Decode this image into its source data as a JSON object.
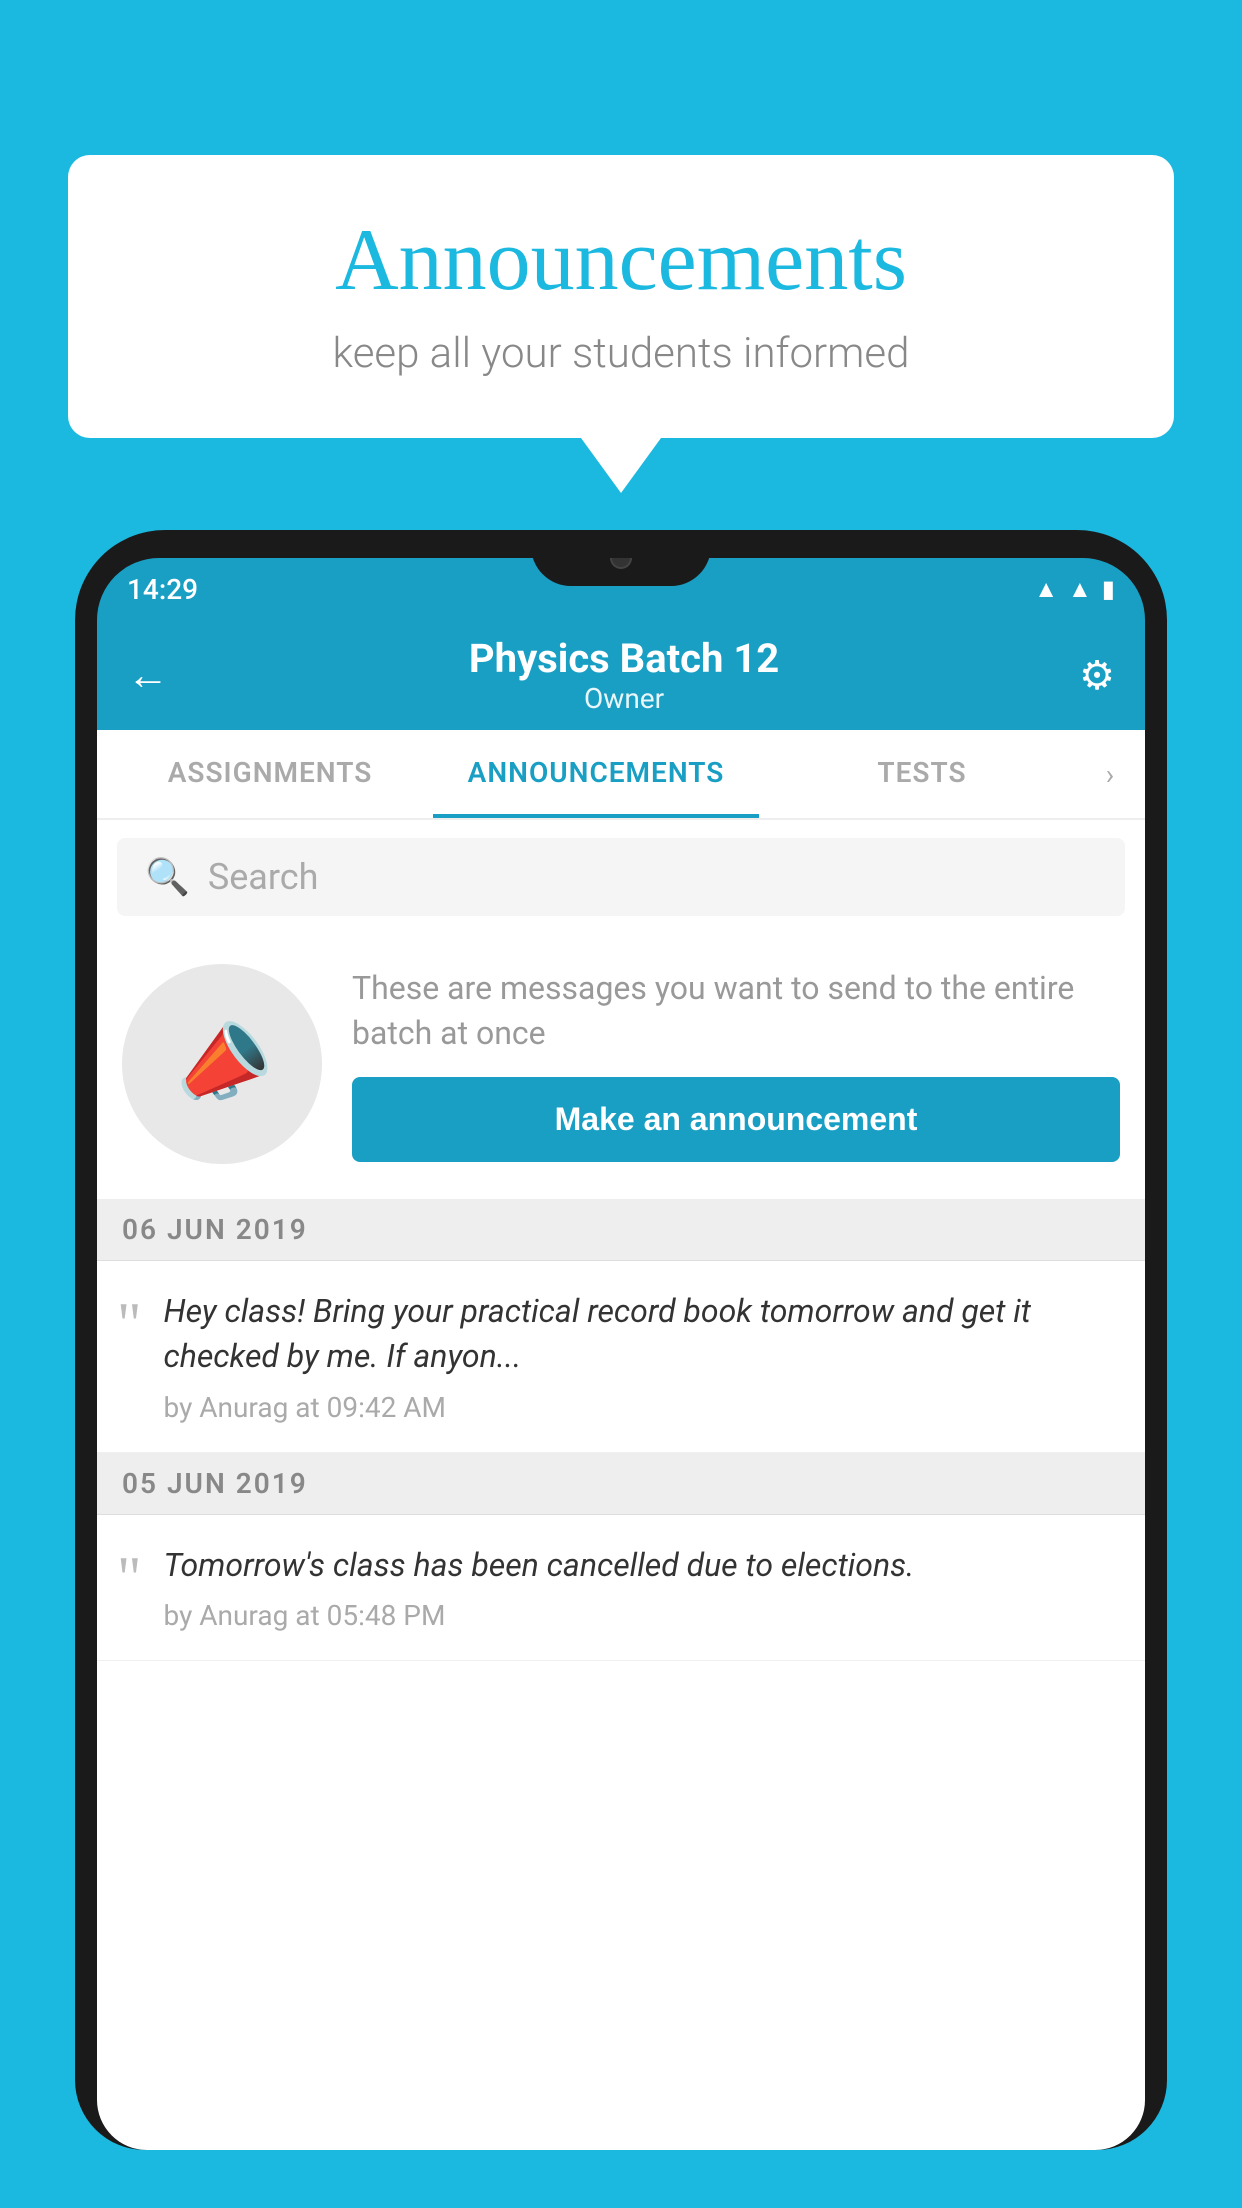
{
  "background_color": "#1bb8e0",
  "speech_bubble": {
    "title": "Announcements",
    "subtitle": "keep all your students informed"
  },
  "phone": {
    "status_bar": {
      "time": "14:29"
    },
    "app_bar": {
      "title": "Physics Batch 12",
      "subtitle": "Owner",
      "back_icon": "←",
      "gear_icon": "⚙"
    },
    "tabs": [
      {
        "label": "ASSIGNMENTS",
        "active": false
      },
      {
        "label": "ANNOUNCEMENTS",
        "active": true
      },
      {
        "label": "TESTS",
        "active": false
      }
    ],
    "search": {
      "placeholder": "Search"
    },
    "announcement_prompt": {
      "description": "These are messages you want to send to the entire batch at once",
      "button_label": "Make an announcement"
    },
    "announcements": [
      {
        "date": "06  JUN  2019",
        "message": "Hey class! Bring your practical record book tomorrow and get it checked by me. If anyon...",
        "meta": "by Anurag at 09:42 AM"
      },
      {
        "date": "05  JUN  2019",
        "message": "Tomorrow's class has been cancelled due to elections.",
        "meta": "by Anurag at 05:48 PM"
      }
    ]
  }
}
